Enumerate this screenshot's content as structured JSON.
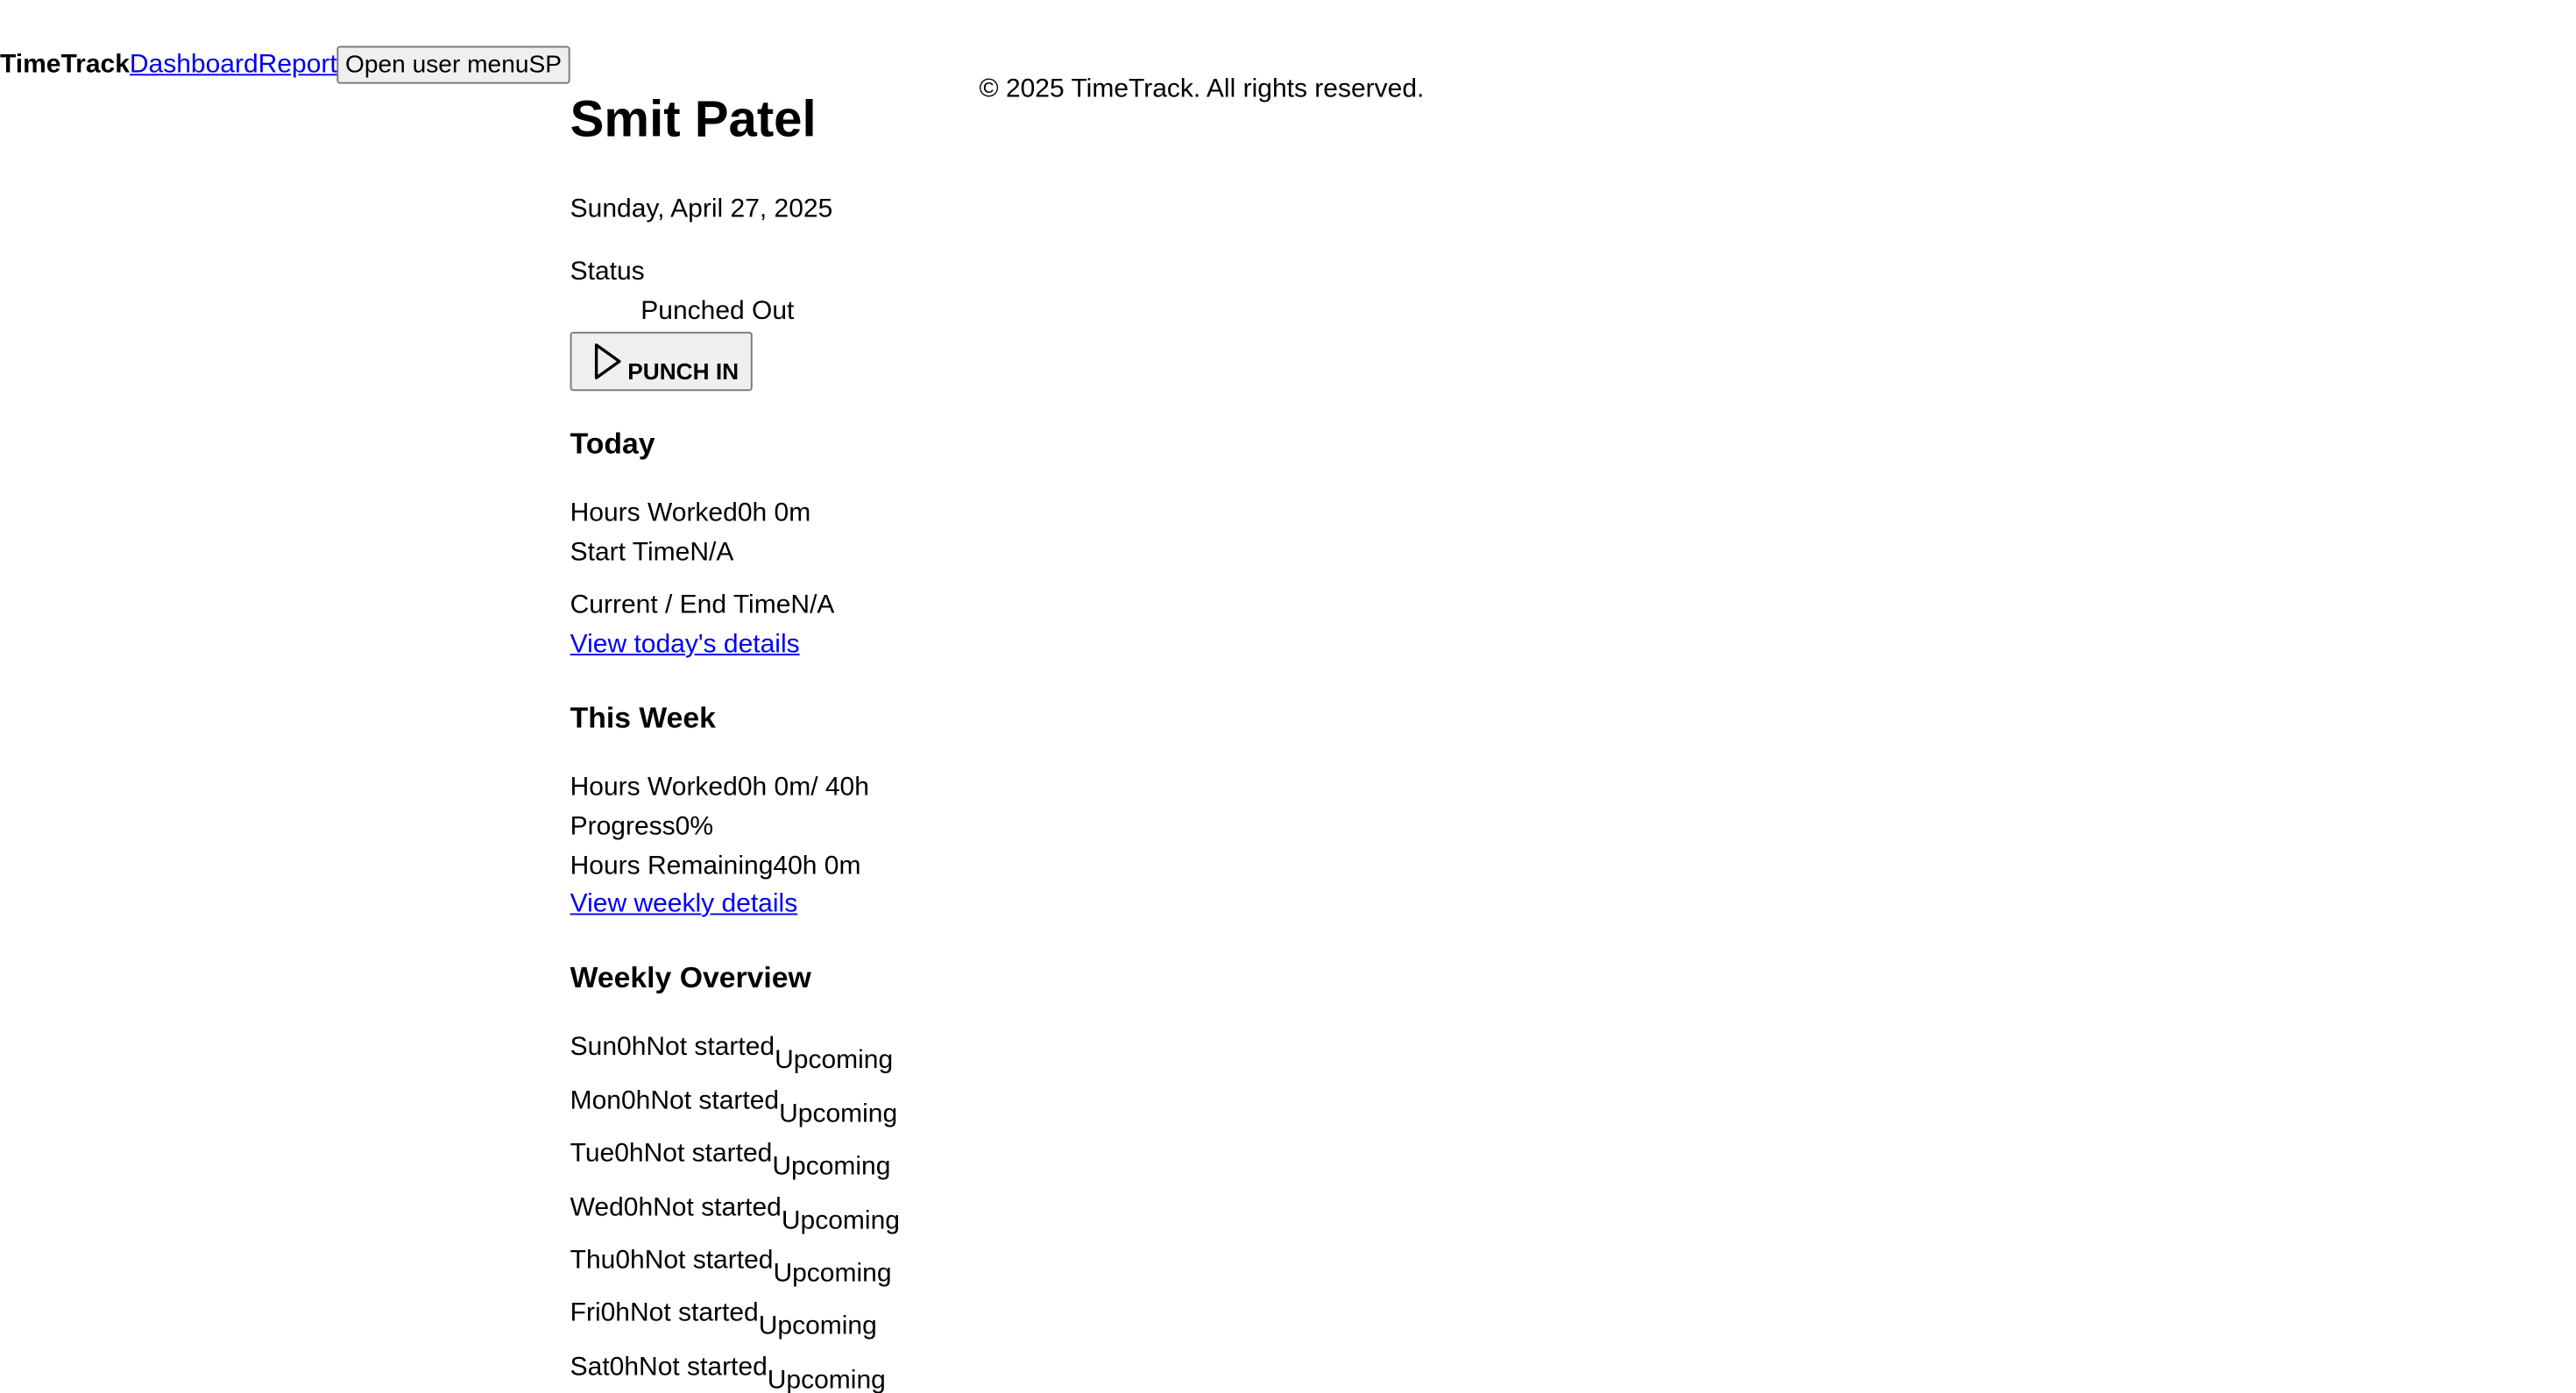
{
  "header": {
    "brand": "TimeTrack",
    "nav": [
      "Dashboard",
      "Reports"
    ],
    "user_menu_label": "Open user menu",
    "user_initials": "SP"
  },
  "footer": {
    "copyright": "© 2025 TimeTrack. All rights reserved."
  },
  "main": {
    "user_name": "Smit Patel",
    "date": "Sunday, April 27, 2025",
    "status_label": "Status",
    "status_value": "Punched Out",
    "punch_button_label": "PUNCH IN",
    "punch_button_icon": "play-icon",
    "today": {
      "title": "Today",
      "hours_worked_label": "Hours Worked",
      "hours_worked_value": "0h 0m",
      "start_time_label": "Start Time",
      "start_time_value": "N/A",
      "end_time_label": "Current / End Time",
      "end_time_value": "N/A",
      "details_link": "View today's details"
    },
    "week": {
      "title": "This Week",
      "hours_worked_label": "Hours Worked",
      "hours_worked_value": "0h 0m",
      "hours_target": "/ 40h",
      "progress_label": "Progress",
      "progress_value": "0%",
      "remaining_label": "Hours Remaining",
      "remaining_value": "40h 0m",
      "details_link": "View weekly details"
    },
    "overview": {
      "title": "Weekly Overview",
      "days": [
        {
          "day": "Sun",
          "hours": "0h",
          "state": "Not started",
          "tag": "Upcoming"
        },
        {
          "day": "Mon",
          "hours": "0h",
          "state": "Not started",
          "tag": "Upcoming"
        },
        {
          "day": "Tue",
          "hours": "0h",
          "state": "Not started",
          "tag": "Upcoming"
        },
        {
          "day": "Wed",
          "hours": "0h",
          "state": "Not started",
          "tag": "Upcoming"
        },
        {
          "day": "Thu",
          "hours": "0h",
          "state": "Not started",
          "tag": "Upcoming"
        },
        {
          "day": "Fri",
          "hours": "0h",
          "state": "Not started",
          "tag": "Upcoming"
        },
        {
          "day": "Sat",
          "hours": "0h",
          "state": "Not started",
          "tag": "Upcoming"
        }
      ]
    }
  }
}
